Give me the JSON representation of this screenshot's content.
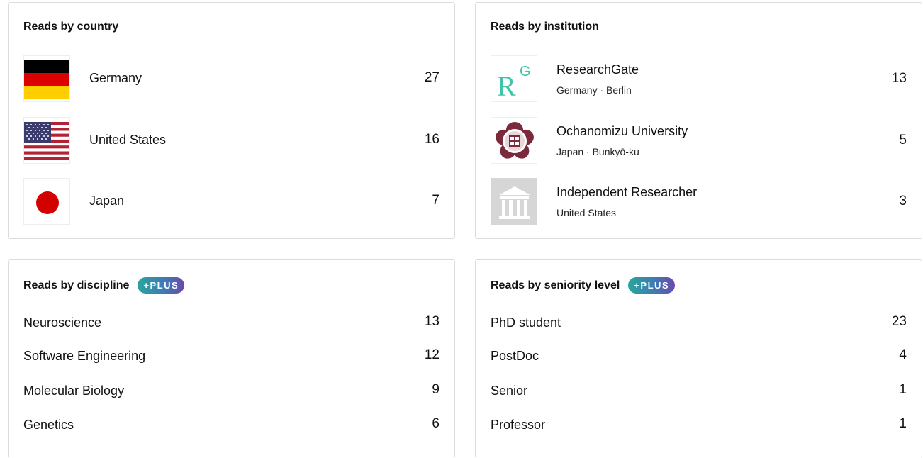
{
  "country_card": {
    "title": "Reads by country",
    "rows": [
      {
        "name": "Germany",
        "count": "27",
        "flag": "germany-flag-icon"
      },
      {
        "name": "United States",
        "count": "16",
        "flag": "usa-flag-icon"
      },
      {
        "name": "Japan",
        "count": "7",
        "flag": "japan-flag-icon"
      }
    ]
  },
  "institution_card": {
    "title": "Reads by institution",
    "rows": [
      {
        "name": "ResearchGate",
        "location": "Germany · Berlin",
        "count": "13",
        "logo": "researchgate-logo-icon",
        "logo_text": "RG"
      },
      {
        "name": "Ochanomizu University",
        "location": "Japan · Bunkyō-ku",
        "count": "5",
        "logo": "university-seal-icon"
      },
      {
        "name": "Independent Researcher",
        "location": "United States",
        "count": "3",
        "logo": "institution-building-icon"
      }
    ]
  },
  "discipline_card": {
    "title": "Reads by discipline",
    "badge": "+PLUS",
    "rows": [
      {
        "label": "Neuroscience",
        "count": "13"
      },
      {
        "label": "Software Engineering",
        "count": "12"
      },
      {
        "label": "Molecular Biology",
        "count": "9"
      },
      {
        "label": "Genetics",
        "count": "6"
      }
    ]
  },
  "seniority_card": {
    "title": "Reads by seniority level",
    "badge": "+PLUS",
    "rows": [
      {
        "label": "PhD student",
        "count": "23"
      },
      {
        "label": "PostDoc",
        "count": "4"
      },
      {
        "label": "Senior",
        "count": "1"
      },
      {
        "label": "Professor",
        "count": "1"
      }
    ]
  },
  "colors": {
    "researchgate_teal": "#40c4a8",
    "seal_maroon": "#7a2a3a",
    "plus_gradient_start": "#2aa59a",
    "plus_gradient_end": "#6c4aa8"
  }
}
